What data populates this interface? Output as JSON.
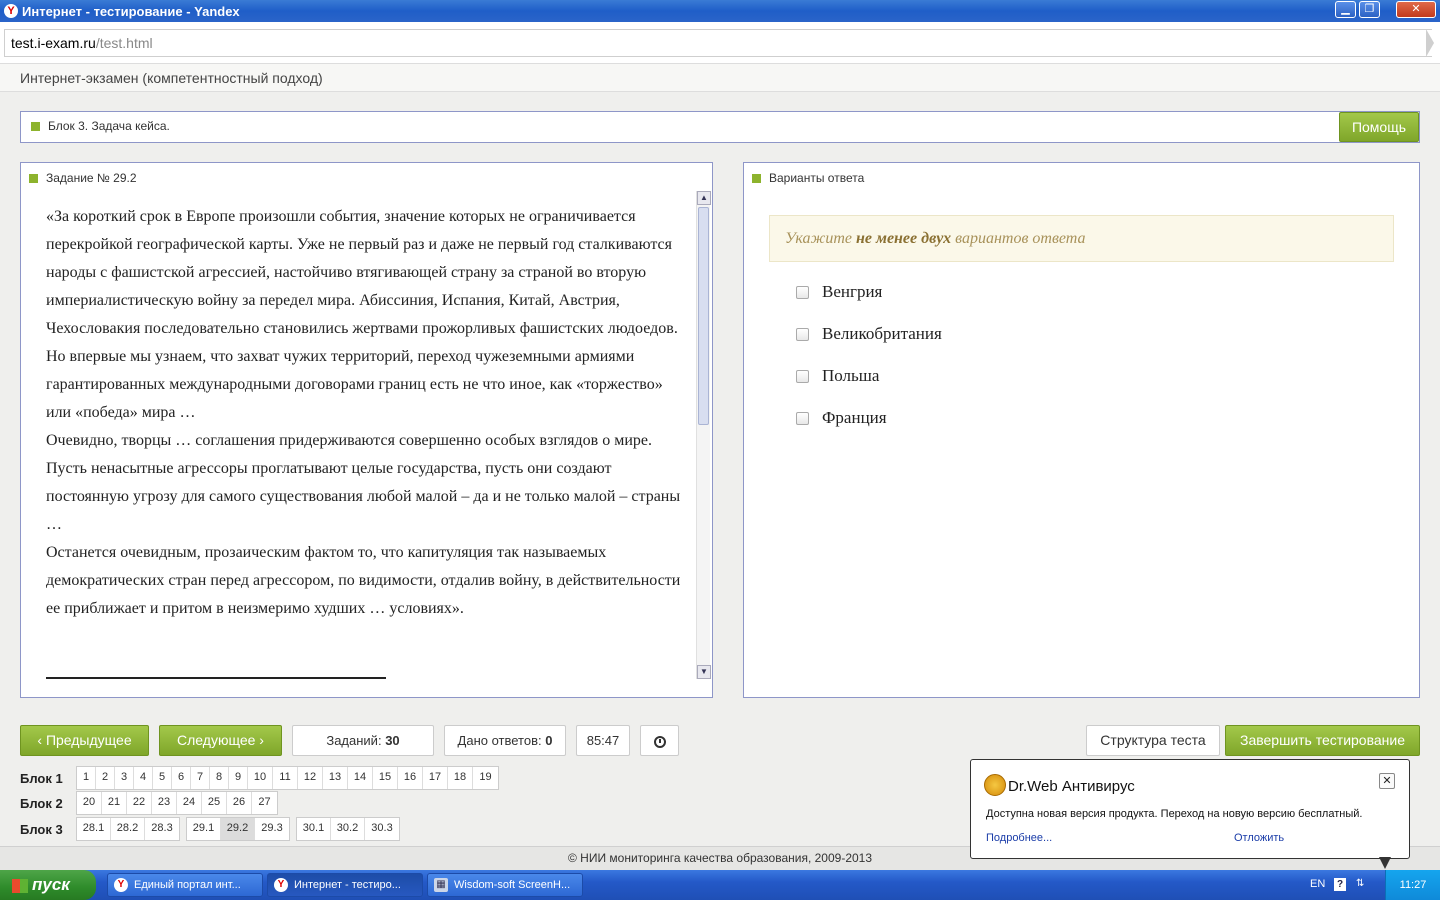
{
  "window": {
    "title": "Интернет - тестирование - Yandex",
    "minimize": "▁",
    "restore": "❐",
    "close": "✕"
  },
  "browser": {
    "url_host": "test.i-exam.ru",
    "url_path": "/test.html"
  },
  "page_header": "Интернет-экзамен (компетентностный подход)",
  "block_bar": {
    "label": "Блок 3. Задача кейса.",
    "help_button": "Помощь"
  },
  "task": {
    "title": "Задание № 29.2",
    "paragraphs": [
      "«За короткий срок в Европе произошли события, значение которых не ограничивается перекройкой географической карты. Уже не первый раз и даже не первый год сталкиваются народы с фашистской агрессией, настойчиво втягивающей страну за страной во вторую империалистическую войну за передел мира. Абиссиния, Испания, Китай, Австрия, Чехословакия последовательно становились жертвами прожорливых фашистских людоедов. Но впервые мы узнаем, что захват чужих территорий, переход чужеземными армиями гарантированных международными договорами границ есть не что иное, как «торжество» или «победа» мира …",
      "Очевидно, творцы … соглашения придерживаются совершенно особых взглядов о мире. Пусть ненасытные агрессоры проглатывают целые государства, пусть они создают постоянную угрозу для самого существования любой малой – да и не только малой – страны …",
      "Останется очевидным, прозаическим фактом то, что капитуляция так называемых демократических стран перед агрессором, по видимости, отдалив войну, в действительности ее приближает и притом в неизмеримо худших … условиях»."
    ],
    "scroll_up": "▲",
    "scroll_down": "▼"
  },
  "answers": {
    "title": "Варианты ответа",
    "hint_prefix": "Укажите ",
    "hint_bold": "не менее двух",
    "hint_suffix": " вариантов ответа",
    "options": [
      "Венгрия",
      "Великобритания",
      "Польша",
      "Франция"
    ]
  },
  "controls": {
    "prev": "Предыдущее",
    "next": "Следующее",
    "tasks_label": "Заданий:",
    "tasks_value": "30",
    "answers_label": "Дано ответов:",
    "answers_value": "0",
    "timer": "85:47",
    "structure": "Структура теста",
    "finish": "Завершить тестирование"
  },
  "blocks": [
    {
      "name": "Блок 1",
      "groups": [
        [
          "1",
          "2",
          "3",
          "4",
          "5",
          "6",
          "7",
          "8",
          "9",
          "10",
          "11",
          "12",
          "13",
          "14",
          "15",
          "16",
          "17",
          "18",
          "19"
        ]
      ]
    },
    {
      "name": "Блок 2",
      "groups": [
        [
          "20",
          "21",
          "22",
          "23",
          "24",
          "25",
          "26",
          "27"
        ]
      ]
    },
    {
      "name": "Блок 3",
      "groups": [
        [
          "28.1",
          "28.2",
          "28.3"
        ],
        [
          "29.1",
          "29.2",
          "29.3"
        ],
        [
          "30.1",
          "30.2",
          "30.3"
        ]
      ],
      "active": "29.2"
    }
  ],
  "footer": "© НИИ мониторинга качества образования, 2009-2013",
  "drweb": {
    "title": "Dr.Web Антивирус",
    "message": "Доступна новая версия продукта. Переход на новую версию бесплатный.",
    "more": "Подробнее...",
    "later": "Отложить",
    "close": "✕"
  },
  "taskbar": {
    "start": "пуск",
    "items": [
      {
        "label": "Единый портал инт...",
        "icon": "yandex-icon"
      },
      {
        "label": "Интернет - тестиро...",
        "icon": "yandex-icon",
        "active": true
      },
      {
        "label": "Wisdom-soft ScreenH...",
        "icon": "screenhunter-icon"
      }
    ],
    "lang": "EN",
    "help": "?",
    "clock": "11:27"
  },
  "colors": {
    "accent_green": "#8db32d",
    "panel_border": "#8e96c8",
    "taskbar_blue": "#2459c8"
  }
}
